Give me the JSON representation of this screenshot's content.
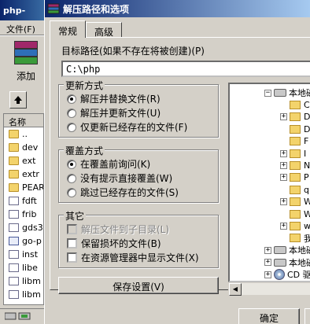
{
  "background_app": {
    "title": "php-",
    "menu_file": "文件(F)",
    "add_label": "添加",
    "list_header": "名称",
    "files": [
      {
        "name": "..",
        "type": "folder"
      },
      {
        "name": "dev",
        "type": "folder"
      },
      {
        "name": "ext",
        "type": "folder"
      },
      {
        "name": "extr",
        "type": "folder"
      },
      {
        "name": "PEAR",
        "type": "folder"
      },
      {
        "name": "fdft",
        "type": "file"
      },
      {
        "name": "frib",
        "type": "file"
      },
      {
        "name": "gds3",
        "type": "file"
      },
      {
        "name": "go-p",
        "type": "file"
      },
      {
        "name": "inst",
        "type": "file"
      },
      {
        "name": "libe",
        "type": "file"
      },
      {
        "name": "libm",
        "type": "file"
      },
      {
        "name": "libm",
        "type": "file"
      }
    ]
  },
  "dialog": {
    "title": "解压路径和选项",
    "tabs": [
      {
        "label": "常规",
        "active": true
      },
      {
        "label": "高级",
        "active": false
      }
    ],
    "target_path_label": "目标路径(如果不存在将被创建)(P)",
    "target_path_value": "C:\\php",
    "update_group": {
      "title": "更新方式",
      "options": [
        {
          "label": "解压并替换文件(R)",
          "checked": true
        },
        {
          "label": "解压并更新文件(U)",
          "checked": false
        },
        {
          "label": "仅更新已经存在的文件(F)",
          "checked": false
        }
      ]
    },
    "overwrite_group": {
      "title": "覆盖方式",
      "options": [
        {
          "label": "在覆盖前询问(K)",
          "checked": true
        },
        {
          "label": "没有提示直接覆盖(W)",
          "checked": false
        },
        {
          "label": "跳过已经存在的文件(S)",
          "checked": false
        }
      ]
    },
    "misc_group": {
      "title": "其它",
      "options": [
        {
          "label": "解压文件到子目录(L)",
          "checked": false,
          "disabled": true
        },
        {
          "label": "保留损坏的文件(B)",
          "checked": false,
          "disabled": false
        },
        {
          "label": "在资源管理器中显示文件(X)",
          "checked": false,
          "disabled": false
        }
      ]
    },
    "save_settings_label": "保存设置(V)",
    "tree": [
      {
        "label": "本地磁",
        "kind": "drive",
        "expander": "−",
        "level": 0
      },
      {
        "label": "C",
        "kind": "folder",
        "expander": "",
        "level": 1
      },
      {
        "label": "D",
        "kind": "folder",
        "expander": "+",
        "level": 1
      },
      {
        "label": "D",
        "kind": "folder",
        "expander": "",
        "level": 1
      },
      {
        "label": "F",
        "kind": "folder",
        "expander": "",
        "level": 1
      },
      {
        "label": "I",
        "kind": "folder",
        "expander": "+",
        "level": 1
      },
      {
        "label": "N",
        "kind": "folder",
        "expander": "+",
        "level": 1
      },
      {
        "label": "P",
        "kind": "folder",
        "expander": "+",
        "level": 1
      },
      {
        "label": "q",
        "kind": "folder",
        "expander": "",
        "level": 1
      },
      {
        "label": "W",
        "kind": "folder",
        "expander": "+",
        "level": 1
      },
      {
        "label": "W",
        "kind": "folder",
        "expander": "",
        "level": 1
      },
      {
        "label": "w",
        "kind": "folder",
        "expander": "+",
        "level": 1
      },
      {
        "label": "我",
        "kind": "folder",
        "expander": "",
        "level": 1
      },
      {
        "label": "本地磁",
        "kind": "drive",
        "expander": "+",
        "level": 0
      },
      {
        "label": "本地磁",
        "kind": "drive",
        "expander": "+",
        "level": 0
      },
      {
        "label": "CD 驱",
        "kind": "cd",
        "expander": "+",
        "level": 0
      }
    ],
    "ok_label": "确定"
  }
}
